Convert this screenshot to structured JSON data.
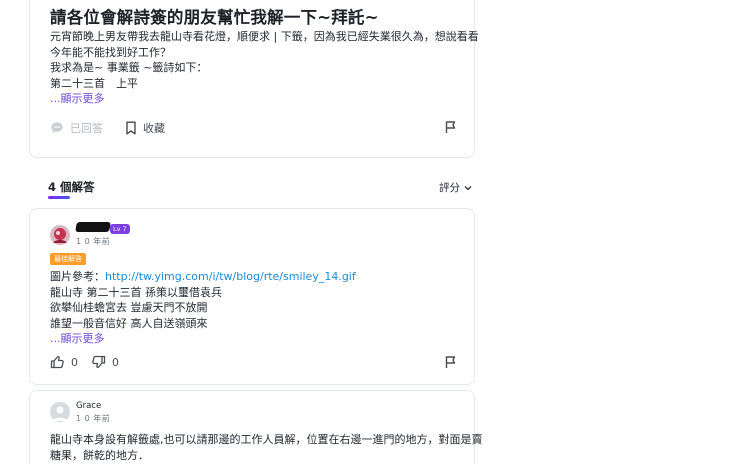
{
  "question": {
    "title": "請各位會解詩簽的朋友幫忙我解一下~拜託~",
    "body_lines": [
      "元宵節晚上男友帶我去龍山寺看花燈，順便求 | 下籤，因為我已經失業很久為，想說看看",
      "今年能不能找到好工作？",
      "我求為是~ 事業籤 ~籤詩如下：",
      "第二十三首　上平"
    ],
    "show_more": "...顯示更多",
    "answer_action": "已回答",
    "bookmark_label": "收藏"
  },
  "answers_section": {
    "count_label": "4 個解答",
    "sort_label": "評分"
  },
  "answer1": {
    "level_badge": "Lv 7",
    "time": "1 0 年前",
    "best_badge": "最佳解答",
    "lines": {
      "ref_prefix": "圖片參考：",
      "ref_link": "http://tw.yimg.com/i/tw/blog/rte/smiley_14.gif",
      "line2": "龍山寺 第二十三首 孫策以璽借袁兵",
      "line3": "欲攀仙桂蟾宮去 豈慮天門不放開",
      "line4": "誰望一般音信好 高人自送嶺頭來"
    },
    "show_more": "...顯示更多",
    "likes": "0",
    "dislikes": "0"
  },
  "answer2": {
    "user": "Grace",
    "time": "1 0 年前",
    "lines": [
      "龍山寺本身設有解籤處,也可以請那邊的工作人員解，位置在右邊一進門的地方，對面是賣",
      "糖果，餅乾的地方．"
    ]
  },
  "colors": {
    "accent_purple": "#6e4bd8",
    "best_badge": "#ff9c2a",
    "link": "#1a8ad8"
  }
}
